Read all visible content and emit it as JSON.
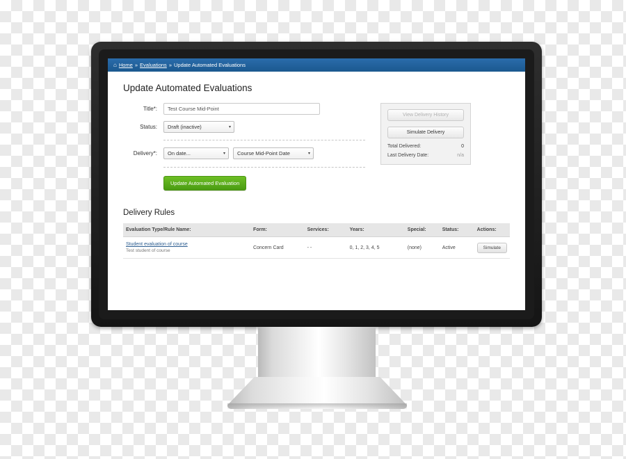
{
  "breadcrumb": {
    "home_icon": "home-icon",
    "home_label": "Home",
    "sep": "»",
    "evaluations_label": "Evaluations",
    "current_label": "Update Automated Evaluations"
  },
  "page": {
    "title": "Update Automated Evaluations"
  },
  "form": {
    "title_label": "Title*:",
    "title_value": "Test Course Mid-Point",
    "title_placeholder": "",
    "status_label": "Status:",
    "status_value": "Draft (inactive)",
    "delivery_label": "Delivery*:",
    "delivery_when_value": "On date...",
    "delivery_date_value": "Course Mid-Point Date",
    "submit_label": "Update Automated Evaluation",
    "caret": "▾"
  },
  "sidebar": {
    "view_history_label": "View Delivery History",
    "simulate_delivery_label": "Simulate Delivery",
    "total_delivered_label": "Total Delivered:",
    "total_delivered_value": "0",
    "last_delivery_label": "Last Delivery Date:",
    "last_delivery_value": "n/a"
  },
  "delivery_rules": {
    "section_title": "Delivery Rules",
    "columns": [
      "Evaluation Type/Rule Name:",
      "Form:",
      "Services:",
      "Years:",
      "Special:",
      "Status:",
      "Actions:"
    ],
    "rows": [
      {
        "rule_name": "Student evaluation of course",
        "rule_sub": "Test student of course",
        "form": "Concern Card",
        "services": "- -",
        "years": "0, 1, 2, 3, 4, 5",
        "special": "(none)",
        "status": "Active",
        "action_label": "Simulate"
      }
    ]
  },
  "colors": {
    "breadcrumb_bar": "#1f5f9c",
    "submit_green": "#59ae18",
    "link_blue": "#2c5d90"
  }
}
